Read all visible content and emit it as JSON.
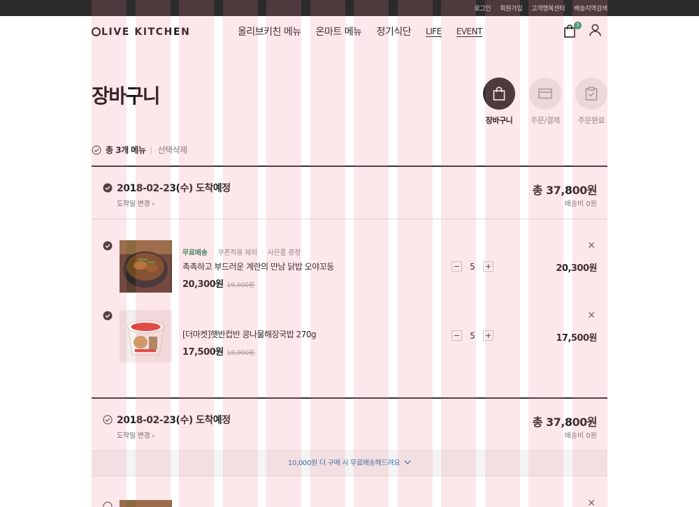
{
  "topbar": {
    "links": [
      "로그인",
      "회원가입",
      "고객행복센터",
      "배송지역검색"
    ]
  },
  "header": {
    "logo": "LIVE KITCHEN",
    "nav": [
      "올리브키친 메뉴",
      "온마트 메뉴",
      "정기식단",
      "LIFE",
      "EVENT"
    ],
    "cart_count": "3"
  },
  "page": {
    "title": "장바구니"
  },
  "steps": [
    {
      "label": "장바구니",
      "icon": "bag-icon",
      "active": true
    },
    {
      "label": "주문/결제",
      "icon": "wallet-icon",
      "active": false
    },
    {
      "label": "주문완료",
      "icon": "clipboard-check-icon",
      "active": false
    }
  ],
  "select_bar": {
    "total_label": "총 3개 메뉴",
    "delete_label": "선택삭제"
  },
  "groups": [
    {
      "date": "2018-02-23(수) 도착예정",
      "change_label": "도착일 변경",
      "total": "총 37,800원",
      "shipping": "배송비 0원",
      "items": [
        {
          "badges": [
            "무료배송",
            "쿠폰적용 제외",
            "사은품 증정"
          ],
          "name": "촉촉하고 부드러운 계란의 만남 닭밥 오야꼬동",
          "price": "20,300원",
          "original_price": "19,900원",
          "qty": "5",
          "line_total": "20,300원",
          "icon": "oyakodon-bowl-photo"
        },
        {
          "badges": [],
          "name": "[더마켓]햇반컵반 콩나물해장국밥 270g",
          "price": "17,500원",
          "original_price": "19,900원",
          "qty": "5",
          "line_total": "17,500원",
          "icon": "cupban-package-photo"
        }
      ]
    },
    {
      "date": "2018-02-23(수) 도착예정",
      "change_label": "도착일 변경",
      "total": "총 37,800원",
      "shipping": "배송비 0원"
    }
  ],
  "free_shipping_notice": "10,000원 더 구매 시 무료배송해드려요",
  "colors": {
    "accent_green": "#2a8a5c",
    "notice_blue": "#2a6ea8",
    "dark": "#2b2b2b"
  }
}
